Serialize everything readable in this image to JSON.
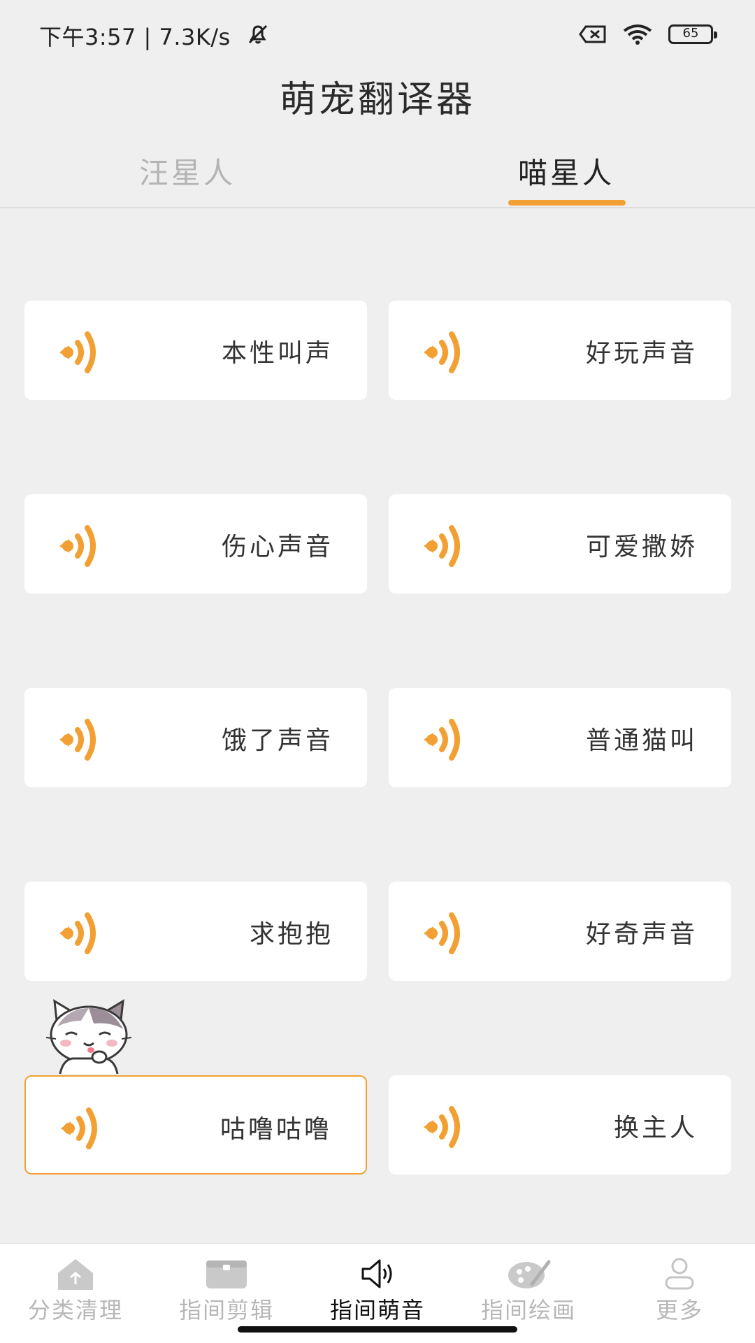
{
  "status_bar": {
    "time_speed": "下午3:57 | 7.3K/s",
    "battery": "65"
  },
  "header": {
    "title": "萌宠翻译器"
  },
  "tabs": [
    {
      "label": "汪星人",
      "selected": false
    },
    {
      "label": "喵星人",
      "selected": true
    }
  ],
  "sounds": [
    {
      "label": "本性叫声"
    },
    {
      "label": "好玩声音"
    },
    {
      "label": "伤心声音"
    },
    {
      "label": "可爱撒娇"
    },
    {
      "label": "饿了声音"
    },
    {
      "label": "普通猫叫"
    },
    {
      "label": "求抱抱"
    },
    {
      "label": "好奇声音"
    },
    {
      "label": "咕噜咕噜",
      "active": true
    },
    {
      "label": "换主人"
    }
  ],
  "bottom_nav": [
    {
      "label": "分类清理",
      "icon": "home-clean-icon"
    },
    {
      "label": "指间剪辑",
      "icon": "clip-box-icon"
    },
    {
      "label": "指间萌音",
      "icon": "speaker-icon",
      "active": true
    },
    {
      "label": "指间绘画",
      "icon": "palette-icon"
    },
    {
      "label": "更多",
      "icon": "person-icon"
    }
  ],
  "colors": {
    "accent": "#f2a033",
    "background": "#efefef"
  }
}
